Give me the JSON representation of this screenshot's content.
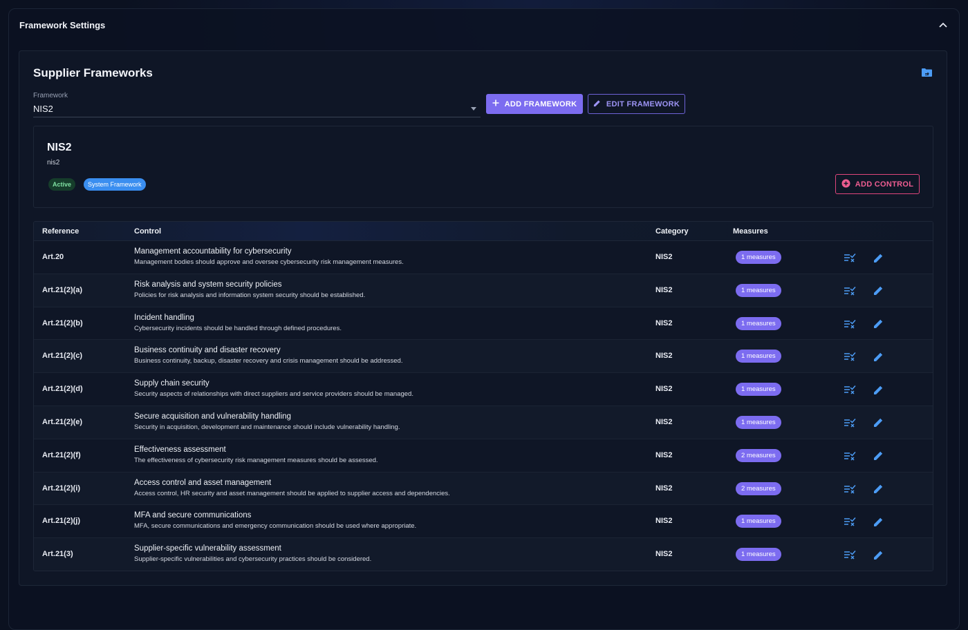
{
  "section": {
    "title": "Framework Settings"
  },
  "card": {
    "title": "Supplier Frameworks",
    "field_label": "Framework",
    "selected_framework": "NIS2",
    "add_framework_label": "ADD FRAMEWORK",
    "edit_framework_label": "EDIT FRAMEWORK"
  },
  "detail": {
    "name": "NIS2",
    "slug": "nis2",
    "status_chip": "Active",
    "type_chip": "System Framework",
    "add_control_label": "ADD CONTROL"
  },
  "table": {
    "headers": {
      "reference": "Reference",
      "control": "Control",
      "category": "Category",
      "measures": "Measures"
    },
    "rows": [
      {
        "ref": "Art.20",
        "name": "Management accountability for cybersecurity",
        "desc": "Management bodies should approve and oversee cybersecurity risk management measures.",
        "category": "NIS2",
        "measures": "1 measures"
      },
      {
        "ref": "Art.21(2)(a)",
        "name": "Risk analysis and system security policies",
        "desc": "Policies for risk analysis and information system security should be established.",
        "category": "NIS2",
        "measures": "1 measures"
      },
      {
        "ref": "Art.21(2)(b)",
        "name": "Incident handling",
        "desc": "Cybersecurity incidents should be handled through defined procedures.",
        "category": "NIS2",
        "measures": "1 measures"
      },
      {
        "ref": "Art.21(2)(c)",
        "name": "Business continuity and disaster recovery",
        "desc": "Business continuity, backup, disaster recovery and crisis management should be addressed.",
        "category": "NIS2",
        "measures": "1 measures"
      },
      {
        "ref": "Art.21(2)(d)",
        "name": "Supply chain security",
        "desc": "Security aspects of relationships with direct suppliers and service providers should be managed.",
        "category": "NIS2",
        "measures": "1 measures"
      },
      {
        "ref": "Art.21(2)(e)",
        "name": "Secure acquisition and vulnerability handling",
        "desc": "Security in acquisition, development and maintenance should include vulnerability handling.",
        "category": "NIS2",
        "measures": "1 measures"
      },
      {
        "ref": "Art.21(2)(f)",
        "name": "Effectiveness assessment",
        "desc": "The effectiveness of cybersecurity risk management measures should be assessed.",
        "category": "NIS2",
        "measures": "2 measures"
      },
      {
        "ref": "Art.21(2)(i)",
        "name": "Access control and asset management",
        "desc": "Access control, HR security and asset management should be applied to supplier access and dependencies.",
        "category": "NIS2",
        "measures": "2 measures"
      },
      {
        "ref": "Art.21(2)(j)",
        "name": "MFA and secure communications",
        "desc": "MFA, secure communications and emergency communication should be used where appropriate.",
        "category": "NIS2",
        "measures": "1 measures"
      },
      {
        "ref": "Art.21(3)",
        "name": "Supplier-specific vulnerability assessment",
        "desc": "Supplier-specific vulnerabilities and cybersecurity practices should be considered.",
        "category": "NIS2",
        "measures": "1 measures"
      }
    ]
  },
  "icons": {
    "collapse": "chevron-up-icon",
    "folder": "folder-sync-icon",
    "add": "plus-icon",
    "edit": "pencil-icon",
    "add_circle": "plus-circle-icon",
    "row_check": "playlist-check-icon",
    "row_edit": "pencil-icon"
  },
  "colors": {
    "accent": "#7c6cf0",
    "danger": "#e0467c",
    "info": "#3a8ef0",
    "success_bg": "#163d2b",
    "icon_blue": "#4c9cf5"
  }
}
